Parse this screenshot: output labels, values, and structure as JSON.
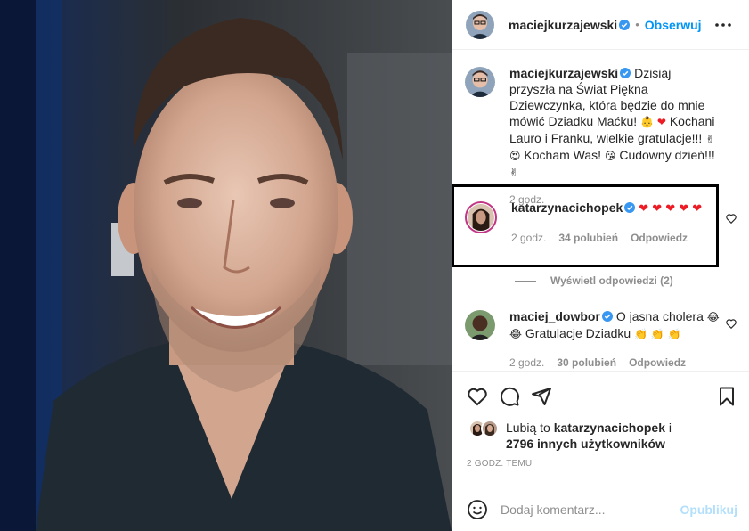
{
  "colors": {
    "accent": "#0095f6",
    "verified": "#3897f0",
    "text": "#262626",
    "muted": "#8e8e8e",
    "heart": "#ed1c24",
    "highlight": "#000000"
  },
  "header": {
    "username": "maciejkurzajewski",
    "separator": "•",
    "follow_label": "Obserwuj",
    "more_icon": "more-horizontal-icon"
  },
  "caption": {
    "username": "maciejkurzajewski",
    "text_1": "Dzisiaj przyszła na Świat Piękna Dziewczynka, która będzie do mnie mówić Dziadku Maćku!",
    "emoji_1": "👶",
    "emoji_2": "❤",
    "text_2": "Kochani Lauro i Franku, wielkie gratulacje!!!",
    "emoji_3": "✌",
    "emoji_4": "😍",
    "text_3": "Kocham Was!",
    "emoji_5": "😘",
    "text_4": "Cudowny dzień!!!",
    "emoji_6": "✌",
    "time": "2 godz."
  },
  "comments": [
    {
      "username": "katarzynacichopek",
      "text": "❤ ❤ ❤ ❤ ❤",
      "time": "2 godz.",
      "likes": "34 polubień",
      "reply_label": "Odpowiedz"
    },
    {
      "username": "maciej_dowbor",
      "text_1": "O jasna cholera",
      "emoji_1": "😂 😂",
      "text_2": "Gratulacje Dziadku",
      "emoji_2": "👏 👏 👏",
      "time": "2 godz.",
      "likes": "30 polubień",
      "reply_label": "Odpowiedz"
    }
  ],
  "view_replies": "Wyświetl odpowiedzi (2)",
  "likes": {
    "prefix": "Lubią to",
    "user": "katarzynacichopek",
    "connector": "i",
    "others": "2796 innych użytkowników"
  },
  "timestamp": "2 GODZ. TEMU",
  "add_comment": {
    "placeholder": "Dodaj komentarz...",
    "publish_label": "Opublikuj"
  }
}
